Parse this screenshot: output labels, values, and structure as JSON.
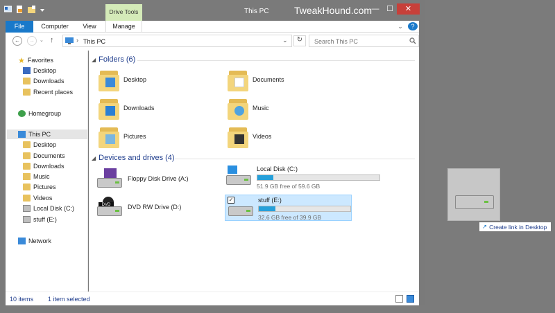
{
  "titlebar": {
    "context_tab": "Drive Tools",
    "title": "This PC",
    "watermark": "TweakHound.com",
    "min_glyph": "—",
    "max_glyph": "☐",
    "close_glyph": "✕"
  },
  "ribbon": {
    "tabs": [
      "File",
      "Computer",
      "View",
      "Manage"
    ],
    "collapse_glyph": "⌄",
    "help_glyph": "?"
  },
  "address": {
    "back_glyph": "←",
    "forward_glyph": "→",
    "up_glyph": "↑",
    "sep_glyph": "›",
    "path": "This PC",
    "dropdown_glyph": "⌄",
    "refresh_glyph": "↻",
    "search_placeholder": "Search This PC"
  },
  "nav": {
    "favorites": {
      "label": "Favorites",
      "items": [
        "Desktop",
        "Downloads",
        "Recent places"
      ]
    },
    "homegroup": "Homegroup",
    "thispc": {
      "label": "This PC",
      "items": [
        "Desktop",
        "Documents",
        "Downloads",
        "Music",
        "Pictures",
        "Videos",
        "Local Disk (C:)",
        "stuff (E:)"
      ]
    },
    "network": "Network"
  },
  "folders": {
    "header": "Folders (6)",
    "items": [
      "Desktop",
      "Documents",
      "Downloads",
      "Music",
      "Pictures",
      "Videos"
    ]
  },
  "devices": {
    "header": "Devices and drives (4)",
    "items": [
      {
        "name": "Floppy Disk Drive (A:)"
      },
      {
        "name": "Local Disk (C:)",
        "free": "51.9 GB free of 59.6 GB",
        "used_fraction": 0.13
      },
      {
        "name": "DVD RW Drive (D:)"
      },
      {
        "name": "stuff (E:)",
        "free": "32.6 GB free of 39.9 GB",
        "used_fraction": 0.18,
        "selected": true
      }
    ]
  },
  "status": {
    "count": "10 items",
    "selected": "1 item selected"
  },
  "drag": {
    "tooltip": "Create link in Desktop"
  },
  "colors": {
    "accent": "#1979ca",
    "selection": "#cce8ff",
    "bar_fill": "#26a0da",
    "context_tab": "#d4eab8"
  }
}
